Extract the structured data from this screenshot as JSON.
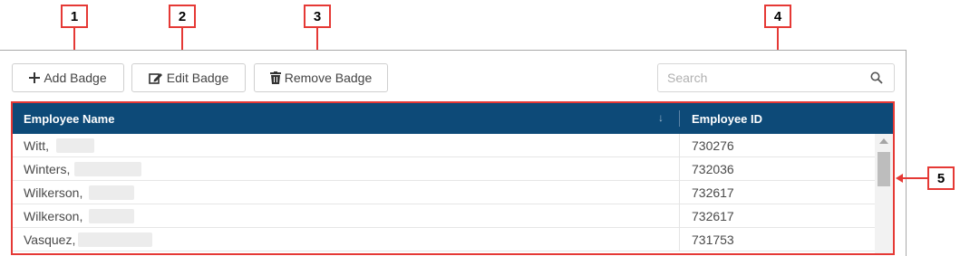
{
  "toolbar": {
    "add_label": "Add Badge",
    "edit_label": "Edit Badge",
    "remove_label": "Remove Badge",
    "add_icon": "plus-icon",
    "edit_icon": "edit-icon",
    "remove_icon": "trash-icon"
  },
  "search": {
    "placeholder": "Search",
    "icon": "search-icon"
  },
  "grid": {
    "columns": [
      "Employee Name",
      "Employee ID"
    ],
    "sort_indicator": "↓",
    "header_color": "#0d4a78",
    "rows": [
      {
        "name": "Witt,",
        "id": "730276"
      },
      {
        "name": "Winters,",
        "id": "732036"
      },
      {
        "name": "Wilkerson,",
        "id": "732617"
      },
      {
        "name": "Wilkerson,",
        "id": "732617"
      },
      {
        "name": "Vasquez,",
        "id": "731753"
      }
    ]
  },
  "callouts": [
    "1",
    "2",
    "3",
    "4",
    "5"
  ],
  "accent_color": "#e53935"
}
